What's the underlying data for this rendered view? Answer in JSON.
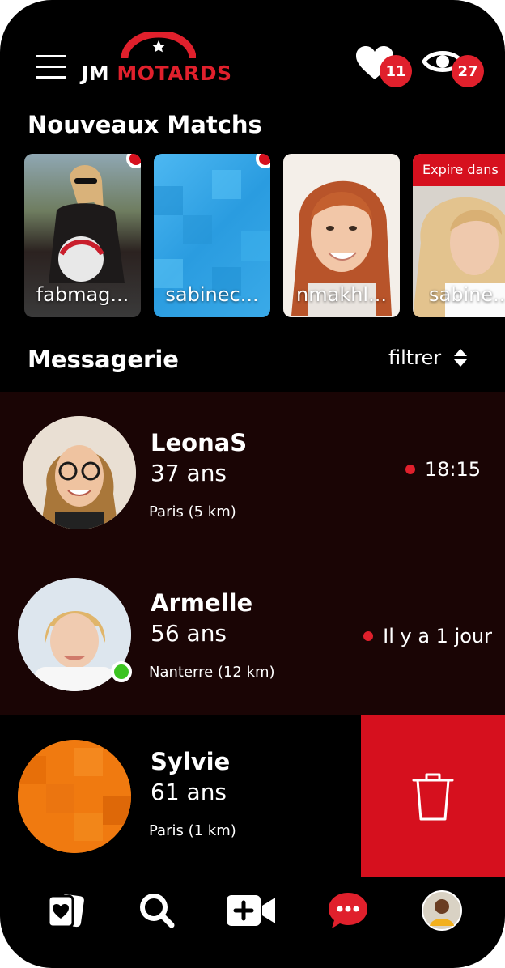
{
  "header": {
    "logo_jm": "JM",
    "logo_motards": "MOTARDS",
    "likes_count": "11",
    "views_count": "27",
    "icons": [
      "menu-icon",
      "heart-icon",
      "eye-icon"
    ]
  },
  "matches": {
    "title": "Nouveaux Matchs",
    "cards": [
      {
        "name": "fabmag...",
        "unread": true
      },
      {
        "name": "sabinec...",
        "unread": true
      },
      {
        "name": "nmakhl...",
        "unread": false
      },
      {
        "name": "sabine...",
        "expire_label": "Expire dans"
      }
    ]
  },
  "messagerie": {
    "title": "Messagerie",
    "filter_label": "filtrer",
    "conversations": [
      {
        "name": "LeonaS",
        "age": "37 ans",
        "city": "Paris (5 km)",
        "time": "18:15"
      },
      {
        "name": "Armelle",
        "age": "56 ans",
        "city": "Nanterre (12 km)",
        "time": "Il y a 1 jour",
        "online": true
      },
      {
        "name": "Sylvie",
        "age": "61 ans",
        "city": "Paris (1 km)"
      }
    ]
  },
  "nav": {
    "items": [
      "cards-icon",
      "search-icon",
      "video-plus-icon",
      "chat-icon",
      "profile-avatar"
    ]
  },
  "colors": {
    "accent": "#e0202c",
    "row_bg": "#1a0505",
    "online": "#3cc421"
  }
}
